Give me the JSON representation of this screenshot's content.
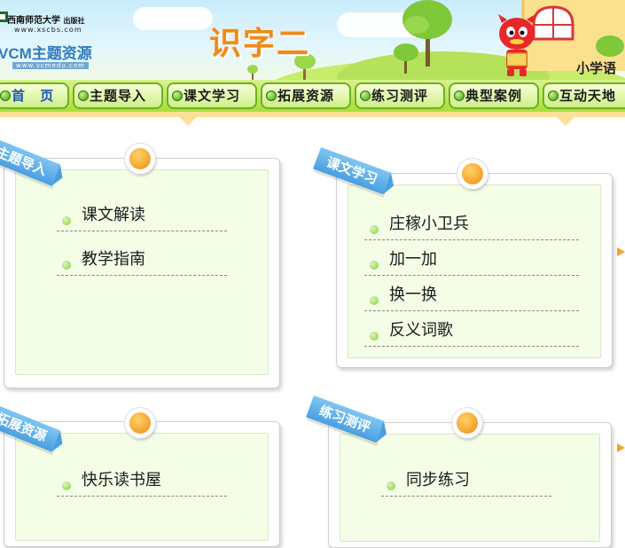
{
  "header": {
    "publisher": "西南师范大学",
    "publisher_suffix": "出版社",
    "publisher_url": "www.xscbs.com",
    "brand": "VCM主题资源",
    "brand_url": "www.vcmedu.com",
    "lesson_title": "识字二",
    "subject": "小学语"
  },
  "nav": {
    "items": [
      {
        "label": "首  页"
      },
      {
        "label": "主题导入"
      },
      {
        "label": "课文学习"
      },
      {
        "label": "拓展资源"
      },
      {
        "label": "练习测评"
      },
      {
        "label": "典型案例"
      },
      {
        "label": "互动天地"
      }
    ]
  },
  "cards": [
    {
      "ribbon": "主题导入",
      "items": [
        "课文解读",
        "教学指南"
      ]
    },
    {
      "ribbon": "课文学习",
      "items": [
        "庄稼小卫兵",
        "加一加",
        "换一换",
        "反义词歌"
      ]
    },
    {
      "ribbon": "拓展资源",
      "items": [
        "快乐读书屋"
      ]
    },
    {
      "ribbon": "练习测评",
      "items": [
        "同步练习"
      ]
    }
  ],
  "colors": {
    "nav_green": "#a8dc3c",
    "title_orange": "#ee8a1b",
    "ribbon_blue": "#4a9fe0",
    "card_bg": "#f4fde6"
  }
}
